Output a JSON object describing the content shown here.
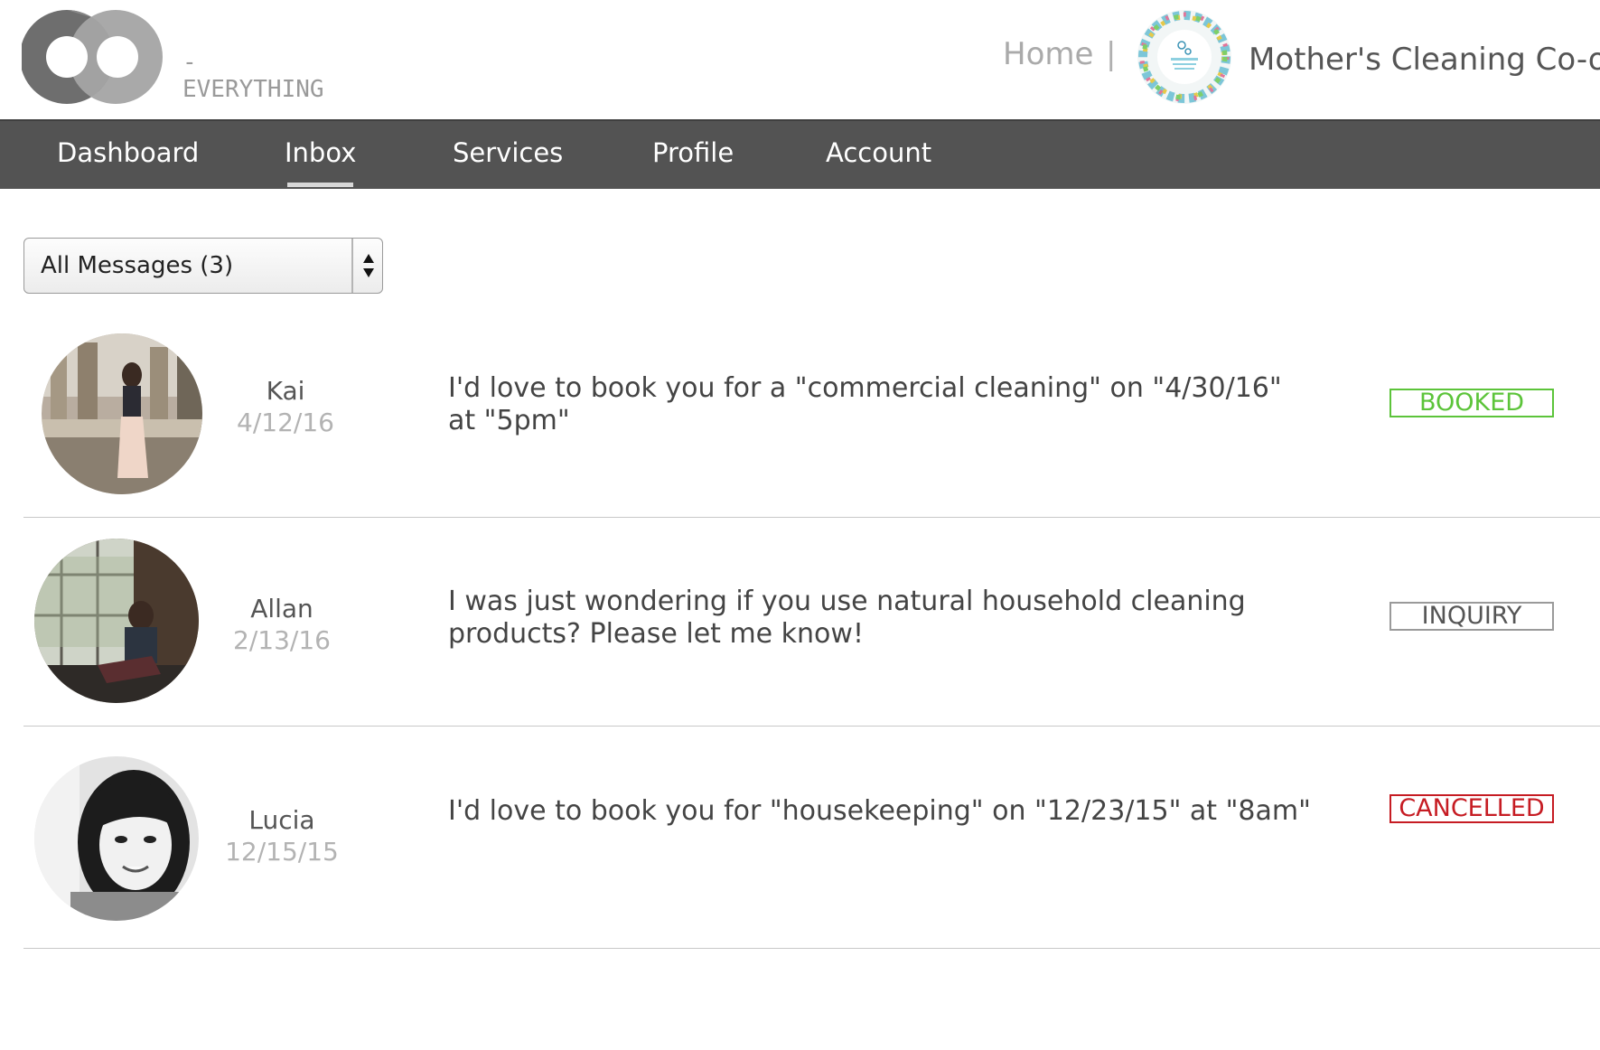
{
  "header": {
    "logo_text": "-EVERYTHING",
    "home_label": "Home",
    "separator": "|",
    "business_name": "Mother's Cleaning Co-op"
  },
  "nav": {
    "items": [
      {
        "label": "Dashboard"
      },
      {
        "label": "Inbox",
        "active": true
      },
      {
        "label": "Services"
      },
      {
        "label": "Profile"
      },
      {
        "label": "Account"
      }
    ]
  },
  "filter": {
    "selected": "All Messages (3)"
  },
  "messages": [
    {
      "name": "Kai",
      "date": "4/12/16",
      "text": "I'd love to book you for a \"commercial cleaning\" on \"4/30/16\" at \"5pm\"",
      "status": "BOOKED"
    },
    {
      "name": "Allan",
      "date": "2/13/16",
      "text": "I was just wondering if you use natural household cleaning products? Please let me know!",
      "status": "INQUIRY"
    },
    {
      "name": "Lucia",
      "date": "12/15/15",
      "text": "I'd love to book you for \"housekeeping\" on \"12/23/15\" at \"8am\"",
      "status": "CANCELLED"
    }
  ],
  "colors": {
    "nav_bg": "#535353",
    "booked": "#5cc43a",
    "inquiry": "#555555",
    "cancelled": "#c61c23"
  }
}
